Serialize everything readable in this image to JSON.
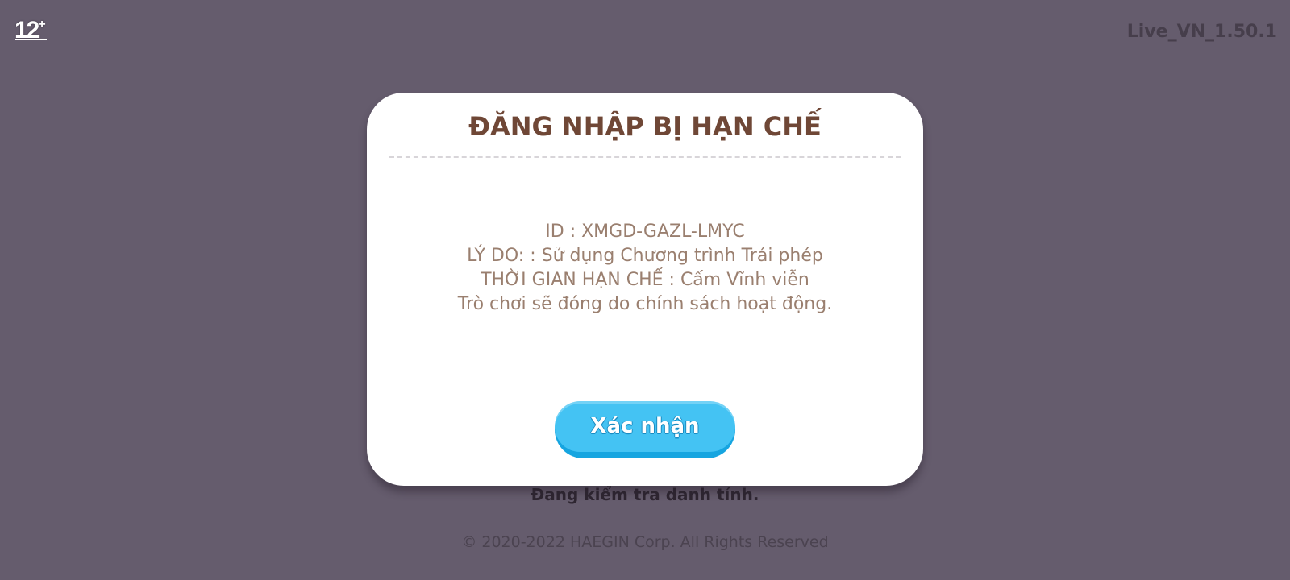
{
  "age_rating": {
    "number": "12",
    "plus": "+"
  },
  "version": "Live_VN_1.50.1",
  "status_text": "Đang kiểm tra danh tính.",
  "copyright": "© 2020-2022 HAEGIN Corp. All Rights Reserved",
  "dialog": {
    "title": "ĐĂNG NHẬP BỊ HẠN CHẾ",
    "lines": [
      "ID : XMGD-GAZL-LMYC",
      "LÝ DO: : Sử dụng Chương trình Trái phép",
      "THỜI GIAN HẠN CHẾ : Cấm Vĩnh viễn",
      "Trò chơi sẽ đóng do chính sách hoạt động."
    ],
    "confirm_label": "Xác nhận"
  },
  "colors": {
    "background": "#655c6d",
    "title": "#6f4736",
    "body_text": "#9a7f6f",
    "button": "#44c3f3"
  }
}
